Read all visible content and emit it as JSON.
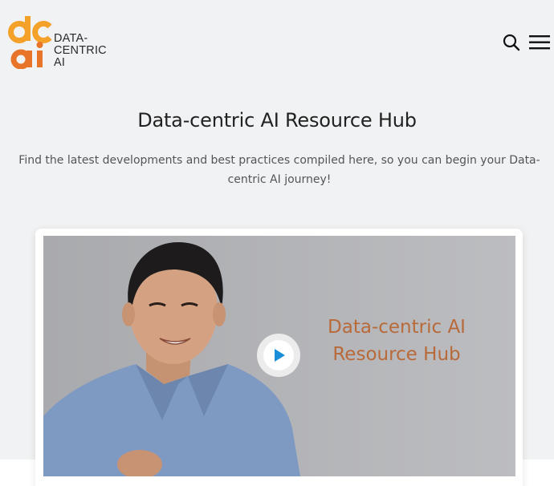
{
  "header": {
    "logo": {
      "mark_top": "dc",
      "mark_bottom": "ai",
      "text_lines": [
        "DATA-",
        "CENTRIC",
        "AI"
      ],
      "brand_color": "#f4a12a",
      "brand_color_secondary": "#e8742a"
    },
    "search_icon": "search-icon",
    "menu_icon": "hamburger-menu-icon"
  },
  "hero": {
    "title": "Data-centric AI Resource Hub",
    "subtitle": "Find the latest developments and best practices compiled here, so you can begin your Data-centric AI journey!"
  },
  "video": {
    "title_lines": [
      "Data-centric AI",
      "Resource Hub"
    ],
    "title_color": "#b86a3a",
    "play_icon": "play-icon",
    "play_color": "#1a8fd8"
  }
}
